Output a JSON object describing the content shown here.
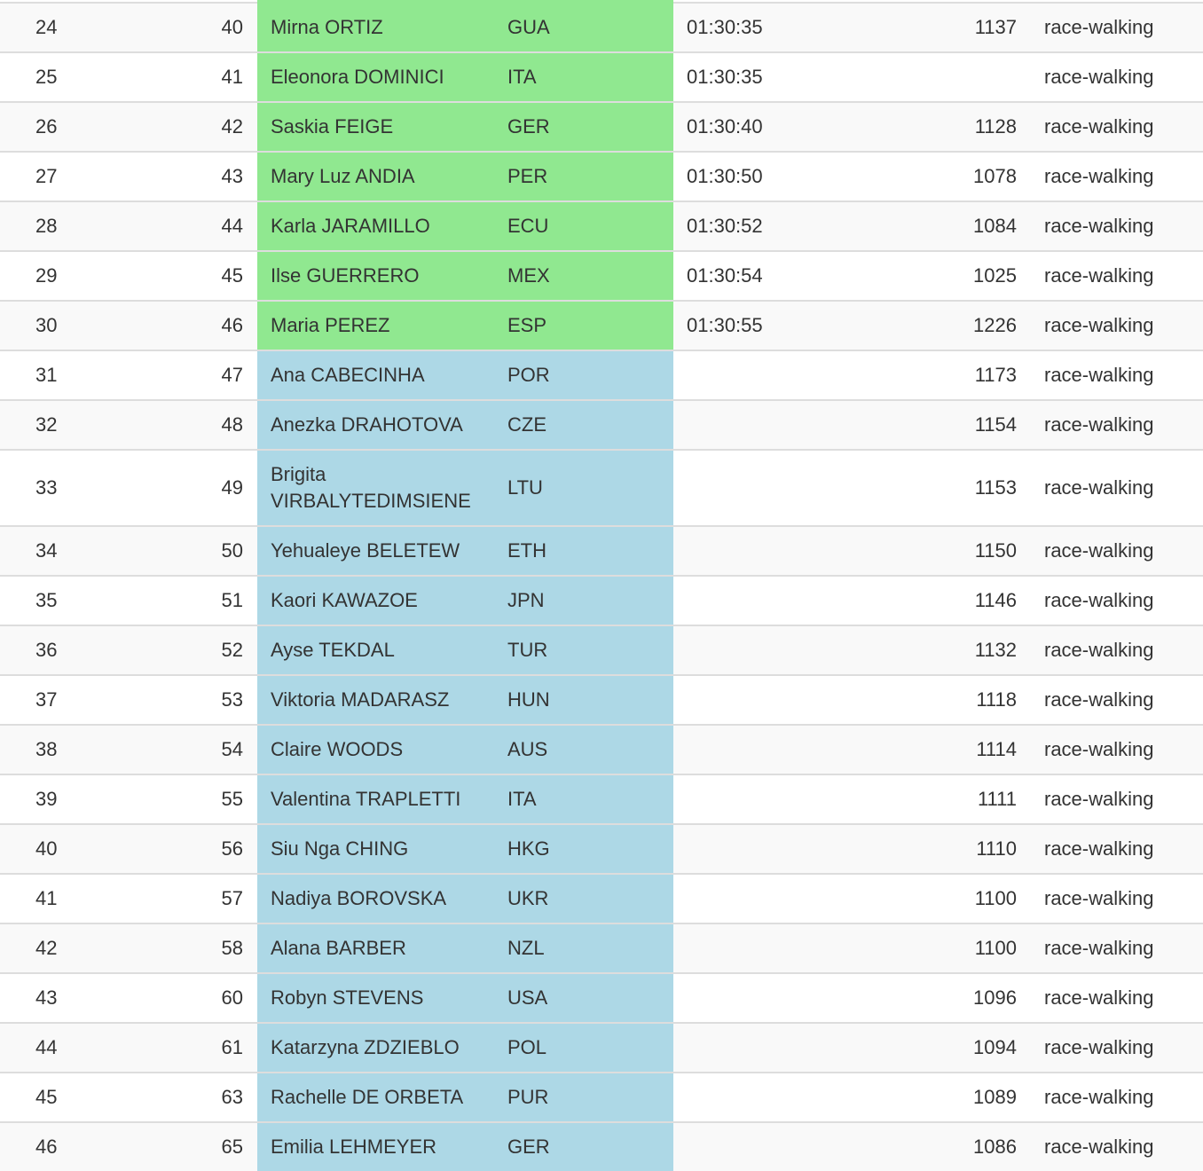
{
  "colors": {
    "qualified_highlight": "#90e890",
    "entry_highlight": "#add8e6",
    "row_alt": "#f9f9f9",
    "border": "#dddddd"
  },
  "rows": [
    {
      "rank": "24",
      "bib": "40",
      "name": "Mirna ORTIZ",
      "nat": "GUA",
      "time": "01:30:35",
      "score": "1137",
      "event": "race-walking",
      "status": "green"
    },
    {
      "rank": "25",
      "bib": "41",
      "name": "Eleonora DOMINICI",
      "nat": "ITA",
      "time": "01:30:35",
      "score": "",
      "event": "race-walking",
      "status": "green"
    },
    {
      "rank": "26",
      "bib": "42",
      "name": "Saskia FEIGE",
      "nat": "GER",
      "time": "01:30:40",
      "score": "1128",
      "event": "race-walking",
      "status": "green"
    },
    {
      "rank": "27",
      "bib": "43",
      "name": "Mary Luz ANDIA",
      "nat": "PER",
      "time": "01:30:50",
      "score": "1078",
      "event": "race-walking",
      "status": "green"
    },
    {
      "rank": "28",
      "bib": "44",
      "name": "Karla JARAMILLO",
      "nat": "ECU",
      "time": "01:30:52",
      "score": "1084",
      "event": "race-walking",
      "status": "green"
    },
    {
      "rank": "29",
      "bib": "45",
      "name": "Ilse GUERRERO",
      "nat": "MEX",
      "time": "01:30:54",
      "score": "1025",
      "event": "race-walking",
      "status": "green"
    },
    {
      "rank": "30",
      "bib": "46",
      "name": "Maria PEREZ",
      "nat": "ESP",
      "time": "01:30:55",
      "score": "1226",
      "event": "race-walking",
      "status": "green"
    },
    {
      "rank": "31",
      "bib": "47",
      "name": "Ana CABECINHA",
      "nat": "POR",
      "time": "",
      "score": "1173",
      "event": "race-walking",
      "status": "blue"
    },
    {
      "rank": "32",
      "bib": "48",
      "name": "Anezka DRAHOTOVA",
      "nat": "CZE",
      "time": "",
      "score": "1154",
      "event": "race-walking",
      "status": "blue"
    },
    {
      "rank": "33",
      "bib": "49",
      "name": "Brigita VIRBALYTEDIMSIENE",
      "nat": "LTU",
      "time": "",
      "score": "1153",
      "event": "race-walking",
      "status": "blue",
      "tall": true
    },
    {
      "rank": "34",
      "bib": "50",
      "name": "Yehualeye BELETEW",
      "nat": "ETH",
      "time": "",
      "score": "1150",
      "event": "race-walking",
      "status": "blue"
    },
    {
      "rank": "35",
      "bib": "51",
      "name": "Kaori KAWAZOE",
      "nat": "JPN",
      "time": "",
      "score": "1146",
      "event": "race-walking",
      "status": "blue"
    },
    {
      "rank": "36",
      "bib": "52",
      "name": "Ayse TEKDAL",
      "nat": "TUR",
      "time": "",
      "score": "1132",
      "event": "race-walking",
      "status": "blue"
    },
    {
      "rank": "37",
      "bib": "53",
      "name": "Viktoria MADARASZ",
      "nat": "HUN",
      "time": "",
      "score": "1118",
      "event": "race-walking",
      "status": "blue"
    },
    {
      "rank": "38",
      "bib": "54",
      "name": "Claire WOODS",
      "nat": "AUS",
      "time": "",
      "score": "1114",
      "event": "race-walking",
      "status": "blue"
    },
    {
      "rank": "39",
      "bib": "55",
      "name": "Valentina TRAPLETTI",
      "nat": "ITA",
      "time": "",
      "score": "1111",
      "event": "race-walking",
      "status": "blue"
    },
    {
      "rank": "40",
      "bib": "56",
      "name": "Siu Nga CHING",
      "nat": "HKG",
      "time": "",
      "score": "1110",
      "event": "race-walking",
      "status": "blue"
    },
    {
      "rank": "41",
      "bib": "57",
      "name": "Nadiya BOROVSKA",
      "nat": "UKR",
      "time": "",
      "score": "1100",
      "event": "race-walking",
      "status": "blue"
    },
    {
      "rank": "42",
      "bib": "58",
      "name": "Alana BARBER",
      "nat": "NZL",
      "time": "",
      "score": "1100",
      "event": "race-walking",
      "status": "blue"
    },
    {
      "rank": "43",
      "bib": "60",
      "name": "Robyn STEVENS",
      "nat": "USA",
      "time": "",
      "score": "1096",
      "event": "race-walking",
      "status": "blue"
    },
    {
      "rank": "44",
      "bib": "61",
      "name": "Katarzyna ZDZIEBLO",
      "nat": "POL",
      "time": "",
      "score": "1094",
      "event": "race-walking",
      "status": "blue"
    },
    {
      "rank": "45",
      "bib": "63",
      "name": "Rachelle DE ORBETA",
      "nat": "PUR",
      "time": "",
      "score": "1089",
      "event": "race-walking",
      "status": "blue"
    },
    {
      "rank": "46",
      "bib": "65",
      "name": "Emilia LEHMEYER",
      "nat": "GER",
      "time": "",
      "score": "1086",
      "event": "race-walking",
      "status": "blue"
    }
  ]
}
